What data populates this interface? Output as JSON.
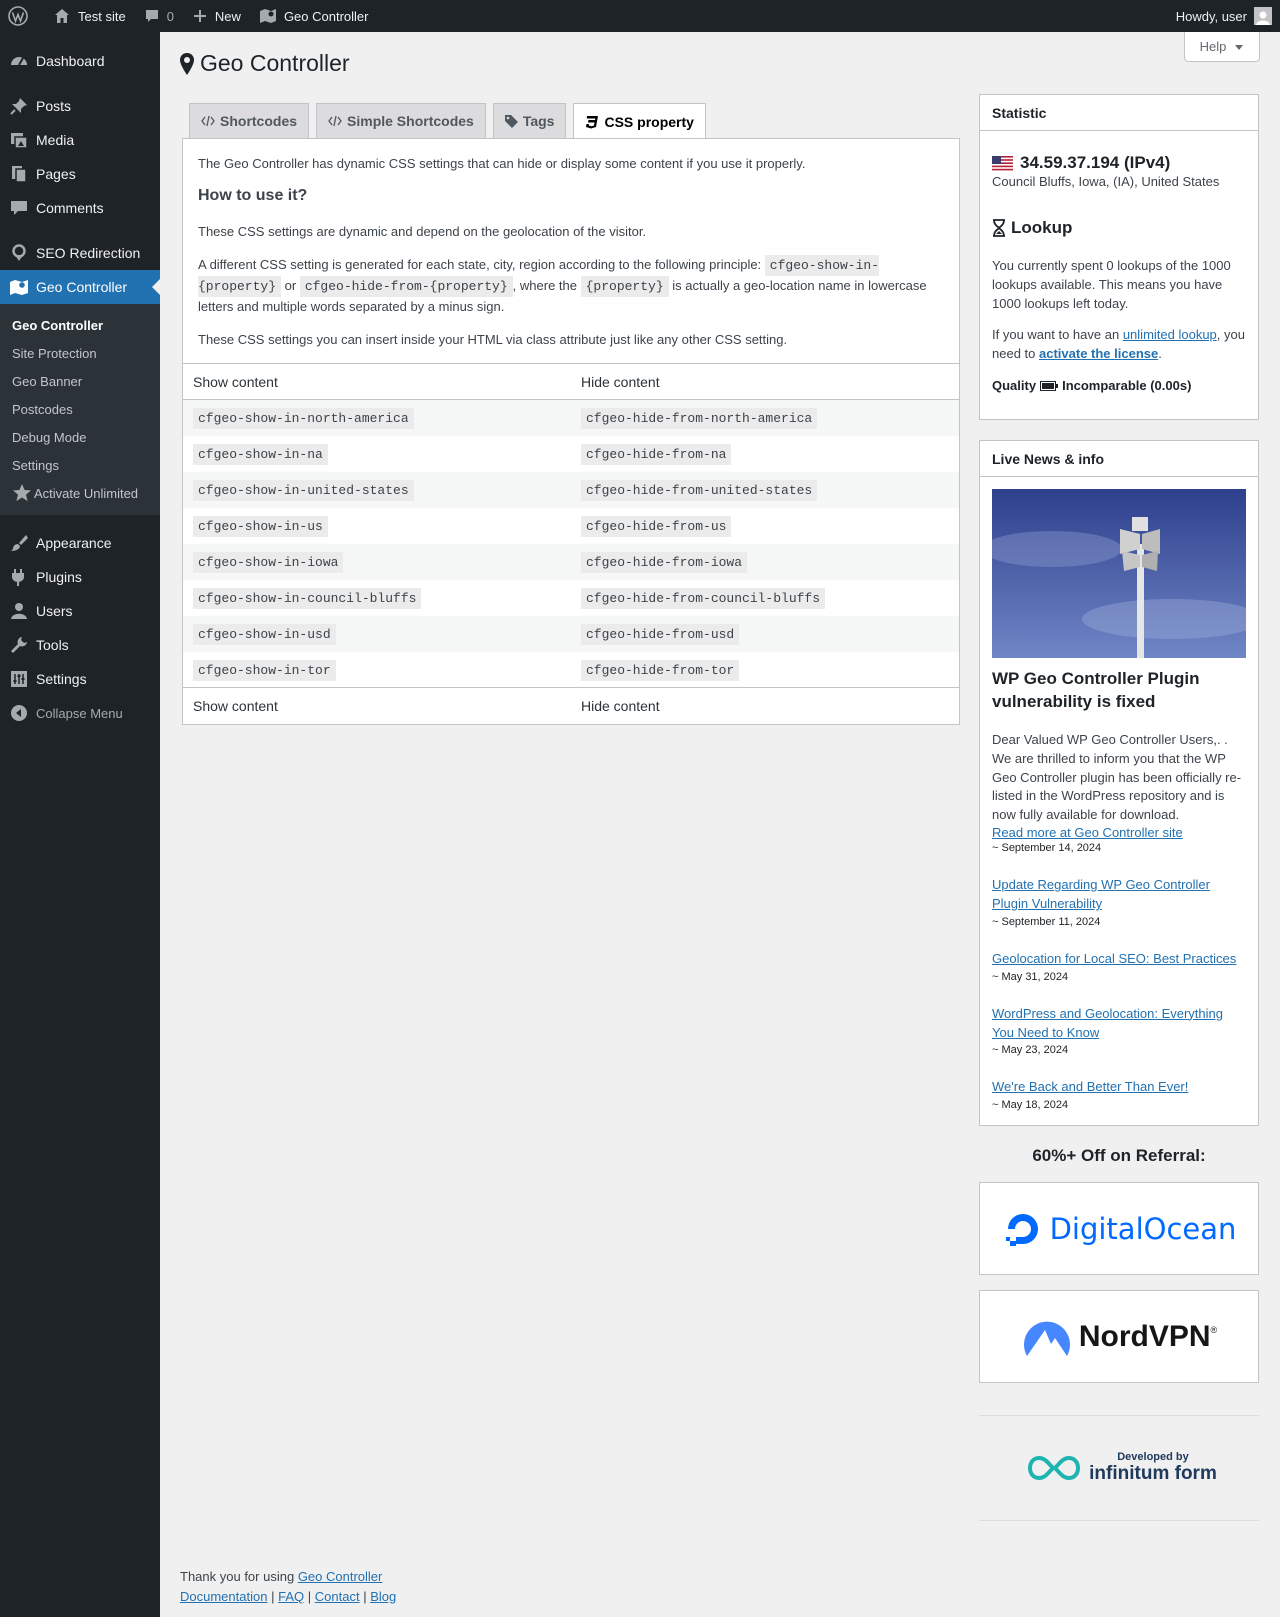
{
  "admin_bar": {
    "site_name": "Test site",
    "comments_count": "0",
    "new_label": "New",
    "plugin_label": "Geo Controller",
    "howdy": "Howdy, user"
  },
  "sidebar": {
    "dashboard": "Dashboard",
    "posts": "Posts",
    "media": "Media",
    "pages": "Pages",
    "comments": "Comments",
    "seo_redirection": "SEO Redirection",
    "geo_controller": "Geo Controller",
    "submenu": {
      "geo_controller": "Geo Controller",
      "site_protection": "Site Protection",
      "geo_banner": "Geo Banner",
      "postcodes": "Postcodes",
      "debug_mode": "Debug Mode",
      "settings": "Settings",
      "activate_unlimited": "Activate Unlimited"
    },
    "appearance": "Appearance",
    "plugins": "Plugins",
    "users": "Users",
    "tools": "Tools",
    "settings": "Settings",
    "collapse": "Collapse Menu"
  },
  "help_label": "Help",
  "page_title": "Geo Controller",
  "tabs": {
    "shortcodes": "Shortcodes",
    "simple_shortcodes": "Simple Shortcodes",
    "tags": "Tags",
    "css_property": "CSS property"
  },
  "content": {
    "intro": "The Geo Controller has dynamic CSS settings that can hide or display some content if you use it properly.",
    "how_heading": "How to use it?",
    "dynamic_text": "These CSS settings are dynamic and depend on the geolocation of the visitor.",
    "principle_a": "A different CSS setting is generated for each state, city, region according to the following principle:",
    "principle_code1": "cfgeo-show-in-{property}",
    "principle_or": "or",
    "principle_code2": "cfgeo-hide-from-{property}",
    "principle_where": ", where the",
    "principle_code3": "{property}",
    "principle_b": "is actually a geo-location name in lowercase letters and multiple words separated by a minus sign.",
    "insert_text": "These CSS settings you can insert inside your HTML via class attribute just like any other CSS setting.",
    "col_show": "Show content",
    "col_hide": "Hide content",
    "rows": [
      {
        "show": "cfgeo-show-in-north-america",
        "hide": "cfgeo-hide-from-north-america"
      },
      {
        "show": "cfgeo-show-in-na",
        "hide": "cfgeo-hide-from-na"
      },
      {
        "show": "cfgeo-show-in-united-states",
        "hide": "cfgeo-hide-from-united-states"
      },
      {
        "show": "cfgeo-show-in-us",
        "hide": "cfgeo-hide-from-us"
      },
      {
        "show": "cfgeo-show-in-iowa",
        "hide": "cfgeo-hide-from-iowa"
      },
      {
        "show": "cfgeo-show-in-council-bluffs",
        "hide": "cfgeo-hide-from-council-bluffs"
      },
      {
        "show": "cfgeo-show-in-usd",
        "hide": "cfgeo-hide-from-usd"
      },
      {
        "show": "cfgeo-show-in-tor",
        "hide": "cfgeo-hide-from-tor"
      }
    ]
  },
  "statistic": {
    "title": "Statistic",
    "ip": "34.59.37.194 (IPv4)",
    "location": "Council Bluffs, Iowa, (IA), United States",
    "lookup_heading": "Lookup",
    "lookup_text": "You currently spent 0 lookups of the 1000 lookups available. This means you have 1000 lookups left today.",
    "license_a": "If you want to have an",
    "unlimited_link": "unlimited lookup",
    "license_b": ", you need to",
    "activate_link": "activate the license",
    "license_c": ".",
    "quality_label": "Quality",
    "quality_value": "Incomparable (0.00s)"
  },
  "news": {
    "title": "Live News & info",
    "featured_title": "WP Geo Controller Plugin vulnerability is fixed",
    "featured_text": "Dear Valued WP Geo Controller Users,. . We are thrilled to inform you that the WP Geo Controller plugin has been officially re-listed in the WordPress repository and is now fully available for download.",
    "read_more": "Read more at Geo Controller site",
    "featured_date": "~ September 14, 2024",
    "items": [
      {
        "title": "Update Regarding WP Geo Controller Plugin Vulnerability",
        "date": "~ September 11, 2024"
      },
      {
        "title": "Geolocation for Local SEO: Best Practices",
        "date": "~ May 31, 2024"
      },
      {
        "title": "WordPress and Geolocation: Everything You Need to Know",
        "date": "~ May 23, 2024"
      },
      {
        "title": "We're Back and Better Than Ever!",
        "date": "~ May 18, 2024"
      }
    ]
  },
  "referral": {
    "heading": "60%+ Off on Referral:",
    "ad1": "DigitalOcean",
    "ad2": "NordVPN",
    "dev_small": "Developed by",
    "dev_big": "infinitum form"
  },
  "footer": {
    "thanks": "Thank you for using",
    "plugin_link": "Geo Controller",
    "documentation": "Documentation",
    "faq": "FAQ",
    "contact": "Contact",
    "blog": "Blog",
    "sep": "|"
  },
  "colors": {
    "admin_dark": "#1d2327",
    "accent": "#2271b1",
    "digitalocean": "#0069ff"
  }
}
